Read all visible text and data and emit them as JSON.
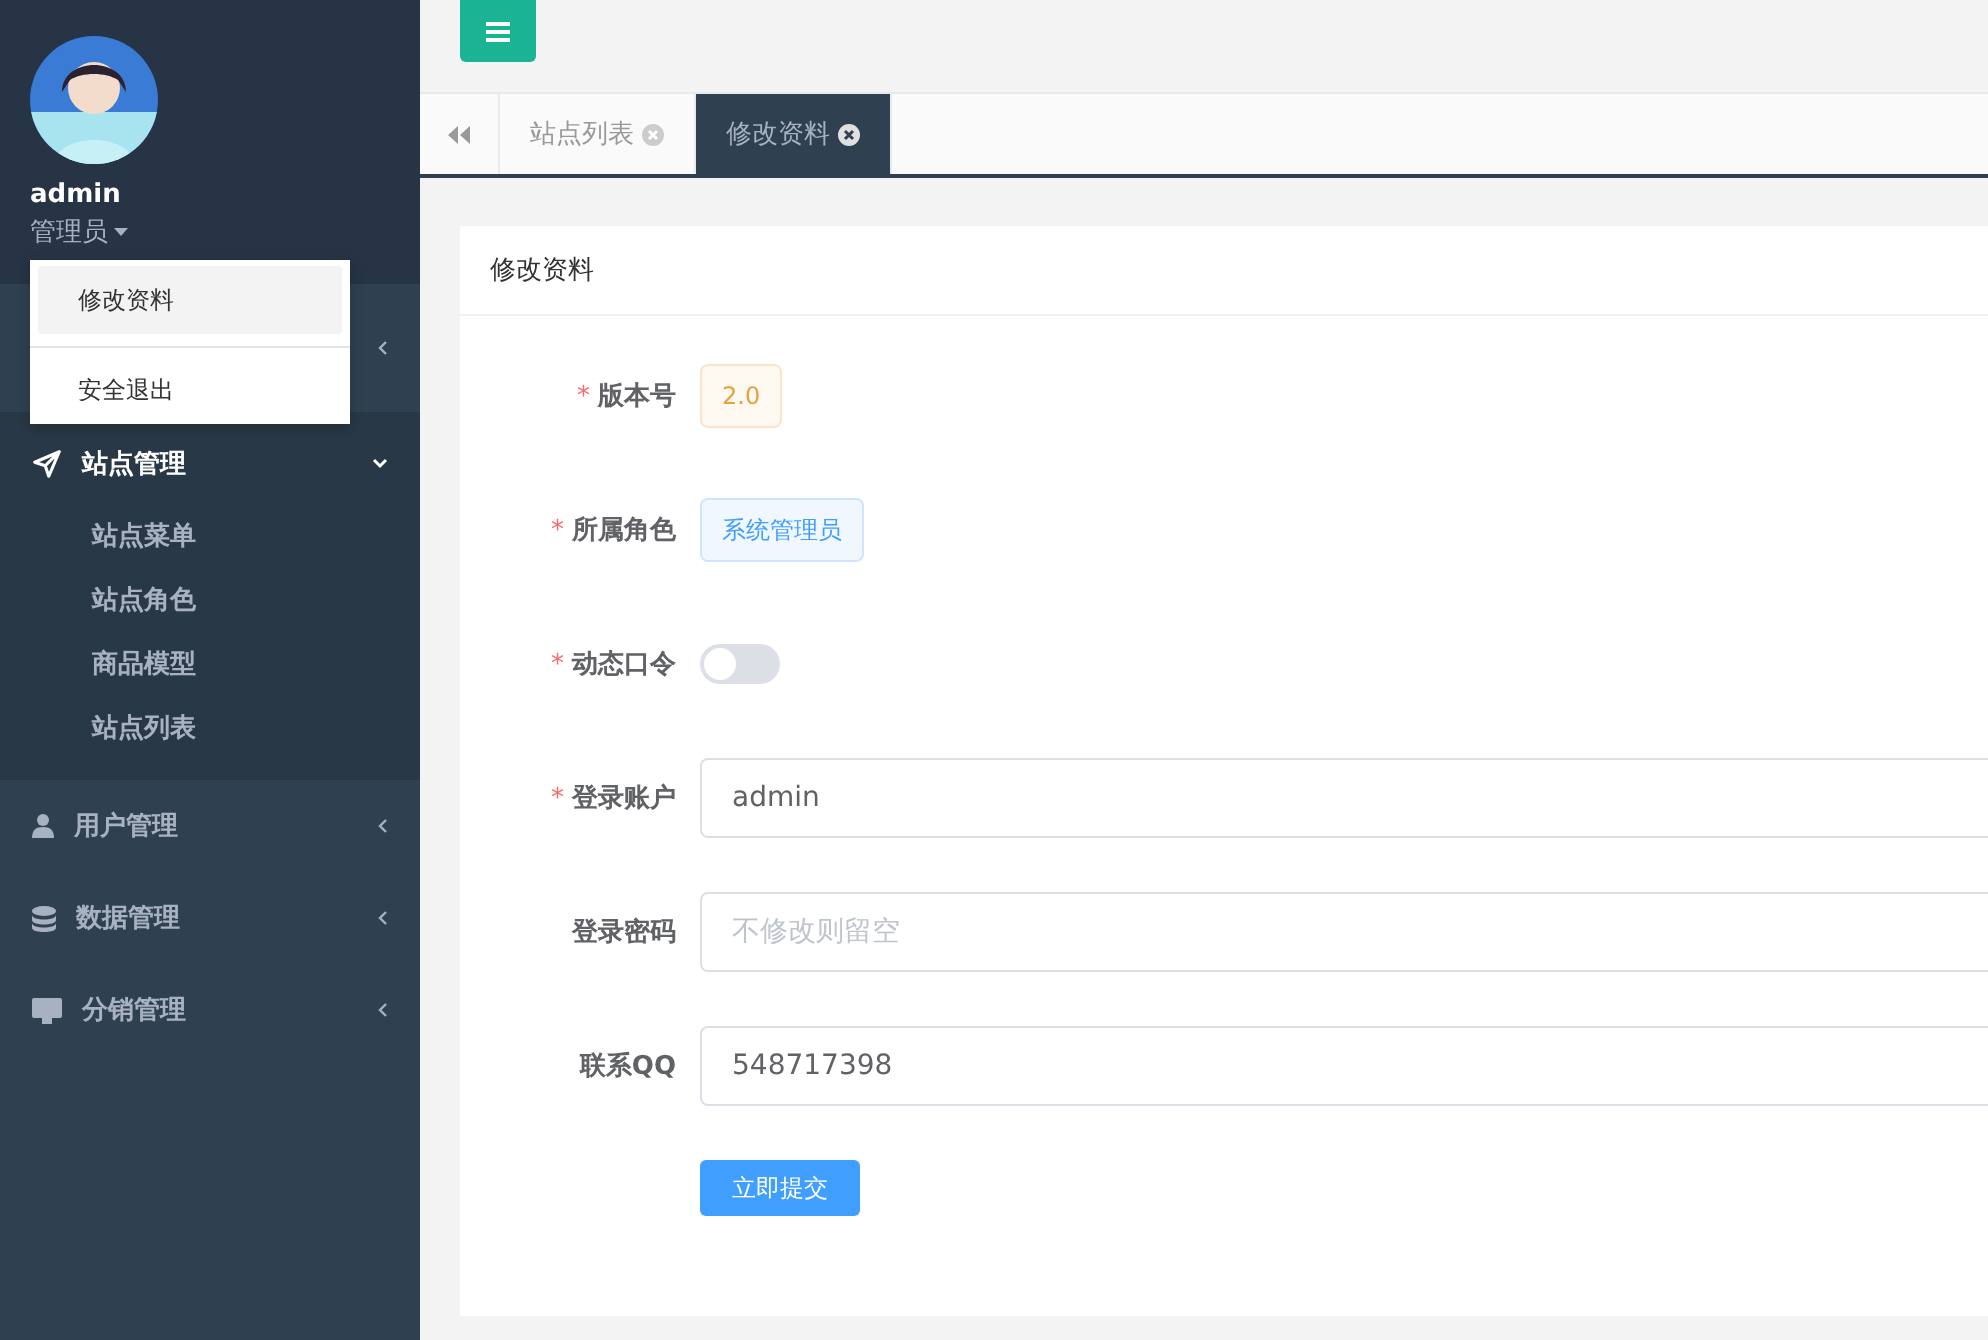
{
  "user": {
    "name": "admin",
    "role": "管理员"
  },
  "user_menu": {
    "open": true,
    "items": [
      {
        "label": "修改资料",
        "selected": true
      },
      {
        "label": "安全退出",
        "selected": false
      }
    ]
  },
  "sidebar": {
    "items": [
      {
        "expanded": false
      },
      {
        "label": "站点管理",
        "expanded": true,
        "children": [
          {
            "label": "站点菜单"
          },
          {
            "label": "站点角色"
          },
          {
            "label": "商品模型"
          },
          {
            "label": "站点列表"
          }
        ]
      },
      {
        "label": "用户管理",
        "expanded": false
      },
      {
        "label": "数据管理",
        "expanded": false
      },
      {
        "label": "分销管理",
        "expanded": false
      }
    ]
  },
  "tabs": [
    {
      "label": "站点列表",
      "selected": false
    },
    {
      "label": "修改资料",
      "selected": true
    }
  ],
  "card": {
    "title": "修改资料",
    "fields": [
      {
        "kind": "tag",
        "label": "版本号",
        "required_mark": "*",
        "value": "2.0",
        "color": "#e6a23c"
      },
      {
        "kind": "tag",
        "label": "所属角色",
        "required_mark": "*",
        "value": "系统管理员",
        "color": "#409eff"
      },
      {
        "kind": "switch",
        "label": "动态口令",
        "required_mark": "*",
        "on": false
      },
      {
        "kind": "input",
        "label": "登录账户",
        "required_mark": "*",
        "value": "admin"
      },
      {
        "kind": "input",
        "label": "登录密码",
        "placeholder": "不修改则留空"
      },
      {
        "kind": "input",
        "label": "联系QQ",
        "value": "548717398"
      }
    ],
    "submit": "立即提交"
  }
}
